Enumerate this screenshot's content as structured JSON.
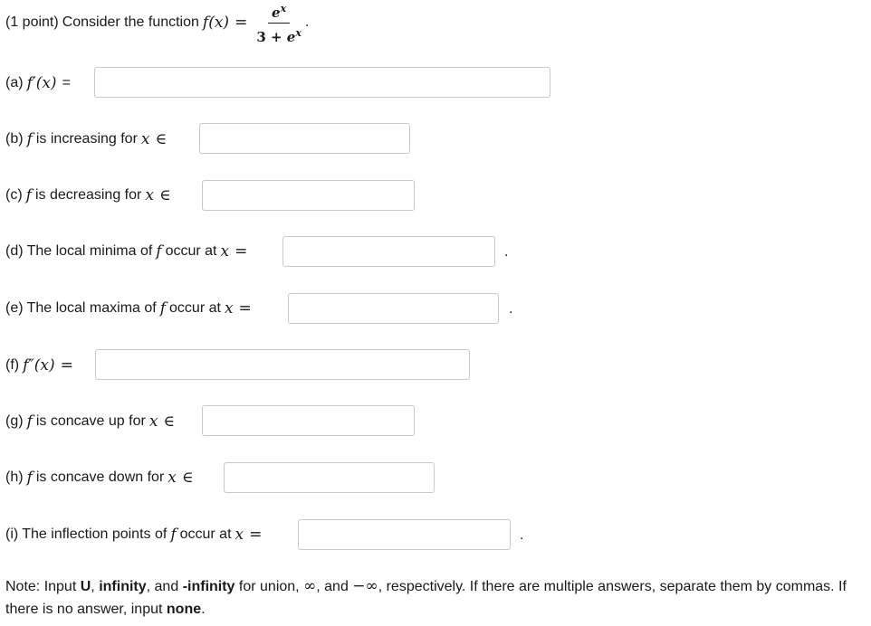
{
  "problem": {
    "points_label": "(1 point)",
    "intro": "Consider the function",
    "function_lhs": "f(x)",
    "equals": "=",
    "numerator": "e^x",
    "denominator_const": "3 +",
    "denominator_exp": "e^x",
    "end_period": "."
  },
  "parts": [
    {
      "label": "(a)",
      "before_text": "",
      "math": "f′(x)",
      "after_math": "",
      "relation": "=",
      "value": "",
      "trailing": ""
    },
    {
      "label": "(b)",
      "before_text": "",
      "math": "f",
      "after_math": "is increasing for",
      "var": "x",
      "relation": "∈",
      "value": "",
      "trailing": ""
    },
    {
      "label": "(c)",
      "before_text": "",
      "math": "f",
      "after_math": "is decreasing for",
      "var": "x",
      "relation": "∈",
      "value": "",
      "trailing": ""
    },
    {
      "label": "(d)",
      "before_text": "The local minima of",
      "math": "f",
      "after_math": "occur at",
      "var": "x",
      "relation": "=",
      "value": "",
      "trailing": "."
    },
    {
      "label": "(e)",
      "before_text": "The local maxima of",
      "math": "f",
      "after_math": "occur at",
      "var": "x",
      "relation": "=",
      "value": "",
      "trailing": "."
    },
    {
      "label": "(f)",
      "before_text": "",
      "math": "f″(x)",
      "after_math": "",
      "relation": "=",
      "value": "",
      "trailing": ""
    },
    {
      "label": "(g)",
      "before_text": "",
      "math": "f",
      "after_math": "is concave up for",
      "var": "x",
      "relation": "∈",
      "value": "",
      "trailing": ""
    },
    {
      "label": "(h)",
      "before_text": "",
      "math": "f",
      "after_math": "is concave down for",
      "var": "x",
      "relation": "∈",
      "value": "",
      "trailing": ""
    },
    {
      "label": "(i)",
      "before_text": "The inflection points of",
      "math": "f",
      "after_math": "occur at",
      "var": "x",
      "relation": "=",
      "value": "",
      "trailing": "."
    }
  ],
  "note": {
    "prefix": "Note: Input",
    "union_key": "U",
    "sep1": ",",
    "infinity_key": "infinity",
    "sep2": ", and",
    "neg_infinity_key": "-infinity",
    "for_text": "for union,",
    "infinity_symbol": "∞",
    "and_text": ", and",
    "neg_infinity_symbol": "−∞",
    "suffix": ", respectively. If there are multiple answers, separate them by commas. If there is no answer, input",
    "none_key": "none",
    "end": "."
  }
}
